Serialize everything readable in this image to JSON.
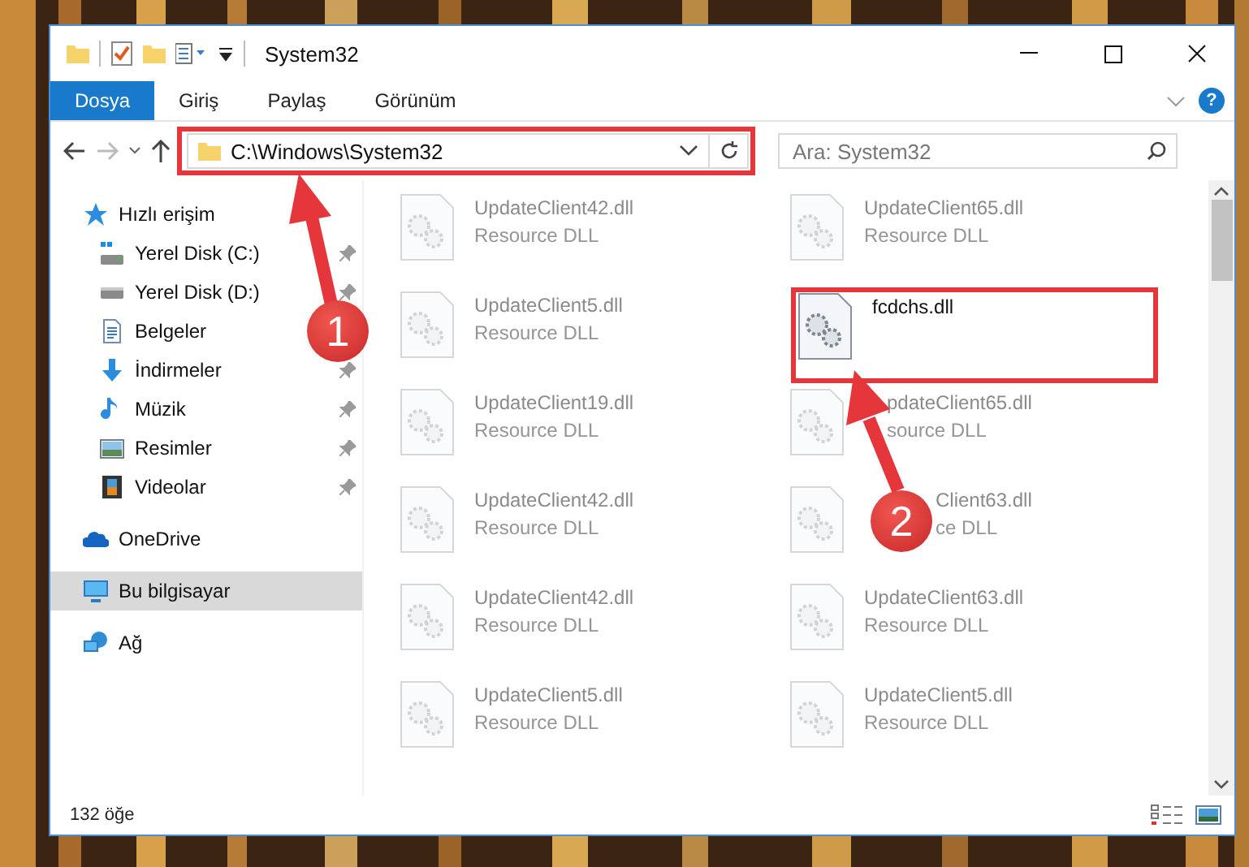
{
  "window": {
    "title": "System32"
  },
  "ribbon_tabs": [
    {
      "label": "Dosya",
      "selected": true
    },
    {
      "label": "Giriş",
      "selected": false
    },
    {
      "label": "Paylaş",
      "selected": false
    },
    {
      "label": "Görünüm",
      "selected": false
    }
  ],
  "help": "?",
  "address": {
    "value": "C:\\Windows\\System32",
    "highlighted": true
  },
  "search": {
    "placeholder": "Ara: System32"
  },
  "sidebar": [
    {
      "label": "Hızlı erişim",
      "kind": "star",
      "selected": false,
      "children": [
        {
          "label": "Yerel Disk (C:)",
          "kind": "sysdrive",
          "selected": false,
          "pinned": true
        },
        {
          "label": "Yerel Disk (D:)",
          "kind": "drive",
          "selected": false,
          "pinned": true
        },
        {
          "label": "Belgeler",
          "kind": "documents",
          "selected": false
        },
        {
          "label": "İndirmeler",
          "kind": "download",
          "selected": false,
          "pinned": true
        },
        {
          "label": "Müzik",
          "kind": "music",
          "selected": false,
          "pinned": true
        },
        {
          "label": "Resimler",
          "kind": "pictures",
          "selected": false,
          "pinned": true
        },
        {
          "label": "Videolar",
          "kind": "videos",
          "selected": false,
          "pinned": true
        }
      ]
    },
    {
      "label": "OneDrive",
      "kind": "cloud",
      "selected": false
    },
    {
      "label": "Bu bilgisayar",
      "kind": "computer",
      "selected": true
    },
    {
      "label": "Ağ",
      "kind": "network",
      "selected": false
    }
  ],
  "files": [
    {
      "name": "UpdateClient42.dll",
      "type": "Resource DLL",
      "blurred": true
    },
    {
      "name": "UpdateClient65.dll",
      "type": "Resource DLL",
      "blurred": true
    },
    {
      "name": "UpdateClient5.dll",
      "type": "Resource DLL",
      "blurred": true
    },
    {
      "name": "fcdchs.dll",
      "blurred": false,
      "highlighted": true
    },
    {
      "name": "UpdateClient19.dll",
      "type": "Resource DLL",
      "blurred": true
    },
    {
      "name": "pdateClient65.dll",
      "type": "source DLL",
      "blurred": true,
      "under_arrow": true
    },
    {
      "name": "UpdateClient42.dll",
      "type": "Resource DLL",
      "blurred": true
    },
    {
      "name": "Client63.dll",
      "type": "ce DLL",
      "blurred": true,
      "under_badge": true
    },
    {
      "name": "UpdateClient42.dll",
      "type": "Resource DLL",
      "blurred": true
    },
    {
      "name": "UpdateClient63.dll",
      "type": "Resource DLL",
      "blurred": true
    },
    {
      "name": "UpdateClient5.dll",
      "type": "Resource DLL",
      "blurred": true
    },
    {
      "name": "UpdateClient5.dll",
      "type": "Resource DLL",
      "blurred": true
    }
  ],
  "status_bar": {
    "count": "132 öğe"
  },
  "annotations": [
    {
      "number": "1"
    },
    {
      "number": "2"
    }
  ]
}
